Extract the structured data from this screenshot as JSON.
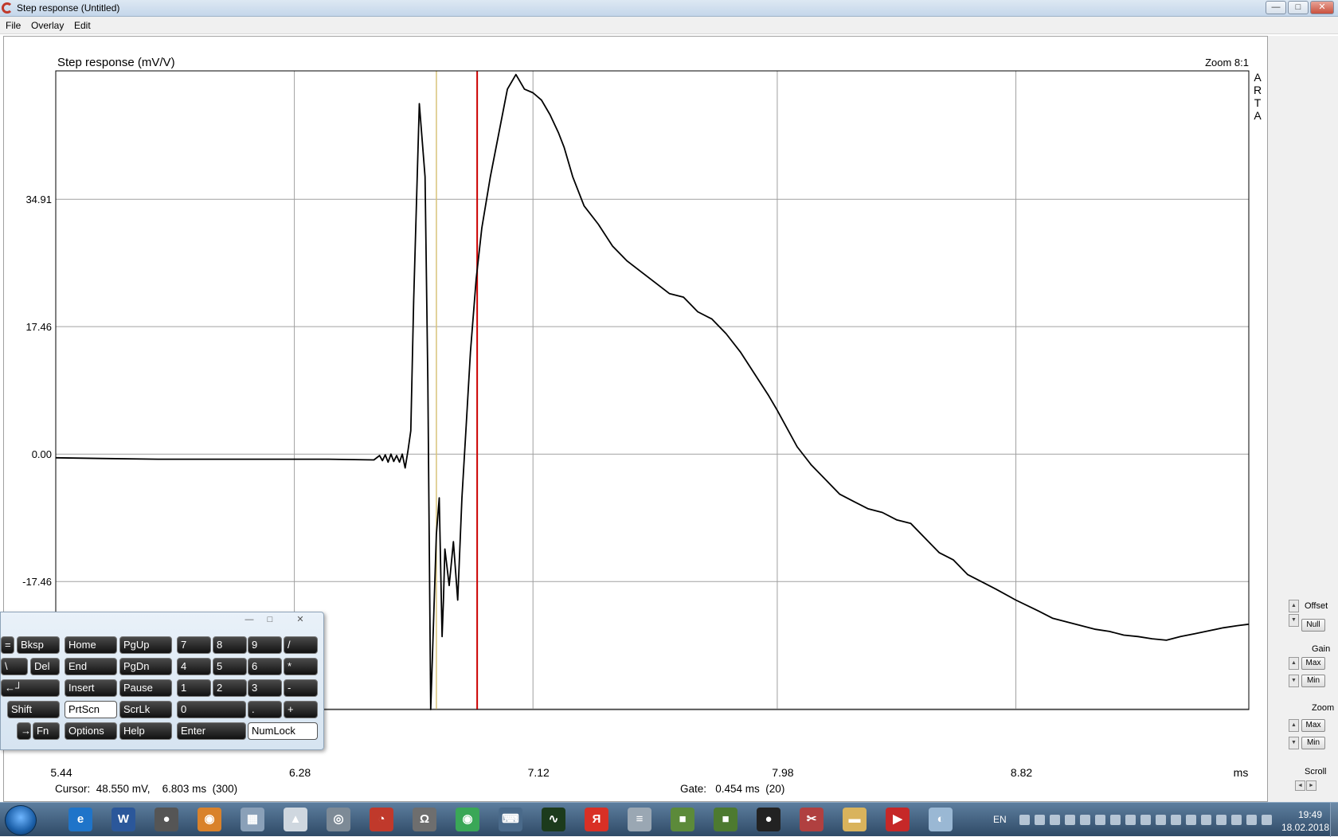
{
  "window": {
    "title": "Step response (Untitled)"
  },
  "menu": [
    "File",
    "Overlay",
    "Edit"
  ],
  "window_buttons": {
    "minimize": "—",
    "maximize": "□",
    "close": "✕"
  },
  "plot": {
    "title": "Step response (mV/V)",
    "zoom": "Zoom 8:1",
    "brand_letters": [
      "A",
      "R",
      "T",
      "A"
    ],
    "x_unit": "ms",
    "y_ticks": [
      "34.91",
      "17.46",
      "0.00",
      "-17.46"
    ],
    "x_ticks": [
      "5.44",
      "6.28",
      "7.12",
      "7.98",
      "8.82"
    ],
    "colors": {
      "trace": "#000000",
      "cursor": "#cc0000",
      "gate": "#d8c27a",
      "grid": "#a0a0a0"
    }
  },
  "chart_data": {
    "type": "line",
    "title": "Step response (mV/V)",
    "xlabel": "ms",
    "ylabel": "",
    "xlim": [
      5.44,
      9.64
    ],
    "ylim": [
      -35.0,
      52.5
    ],
    "x_ticks": [
      5.44,
      6.28,
      7.12,
      7.98,
      8.82
    ],
    "y_ticks": [
      34.91,
      17.46,
      0.0,
      -17.46
    ],
    "grid": true,
    "cursor_x": 6.803,
    "cursor_y": 48.55,
    "gate_x": 6.78,
    "series": [
      {
        "x": [
          5.44,
          5.6,
          5.8,
          6.0,
          6.2,
          6.4,
          6.56,
          6.58,
          6.59,
          6.6,
          6.61,
          6.62,
          6.63,
          6.64,
          6.65,
          6.66,
          6.67,
          6.68,
          6.69,
          6.7,
          6.72,
          6.74,
          6.75,
          6.76,
          6.78,
          6.79,
          6.8,
          6.805,
          6.81,
          6.825,
          6.84,
          6.855,
          6.87,
          6.885,
          6.9,
          6.92,
          6.94,
          6.97,
          7.0,
          7.03,
          7.06,
          7.09,
          7.12,
          7.15,
          7.18,
          7.21,
          7.23,
          7.26,
          7.3,
          7.35,
          7.4,
          7.45,
          7.5,
          7.55,
          7.6,
          7.65,
          7.7,
          7.75,
          7.8,
          7.85,
          7.9,
          7.95,
          7.98,
          8.05,
          8.1,
          8.15,
          8.2,
          8.25,
          8.3,
          8.35,
          8.4,
          8.45,
          8.5,
          8.55,
          8.6,
          8.65,
          8.7,
          8.75,
          8.82,
          8.9,
          8.95,
          9.0,
          9.05,
          9.1,
          9.15,
          9.2,
          9.25,
          9.3,
          9.35,
          9.4,
          9.45,
          9.5,
          9.55,
          9.6,
          9.64
        ],
        "y": [
          -0.5,
          -0.6,
          -0.7,
          -0.7,
          -0.7,
          -0.7,
          -0.8,
          -0.2,
          -0.9,
          -0.1,
          -1.1,
          0.0,
          -1.0,
          -0.2,
          -1.1,
          0.0,
          -1.9,
          0.5,
          3.2,
          21.0,
          48.0,
          38.0,
          10.0,
          -35.0,
          -11.0,
          -6.0,
          -25.0,
          -20.0,
          -13.0,
          -18.0,
          -12.0,
          -20.0,
          -6.0,
          4.0,
          14.0,
          24.0,
          31.0,
          38.0,
          44.0,
          50.0,
          52.0,
          50.0,
          49.5,
          48.5,
          46.5,
          44.0,
          42.0,
          38.0,
          34.0,
          31.5,
          28.5,
          26.5,
          25.0,
          23.5,
          22.0,
          21.5,
          19.5,
          18.5,
          16.5,
          14.0,
          11.0,
          8.0,
          6.0,
          1.0,
          -1.5,
          -3.5,
          -5.5,
          -6.5,
          -7.5,
          -8.0,
          -9.0,
          -9.5,
          -11.5,
          -13.5,
          -14.5,
          -16.5,
          -17.5,
          -18.5,
          -20.0,
          -21.5,
          -22.5,
          -23.0,
          -23.5,
          -24.0,
          -24.3,
          -24.8,
          -25.0,
          -25.3,
          -25.5,
          -25.0,
          -24.6,
          -24.2,
          -23.8,
          -23.5,
          -23.3
        ]
      }
    ]
  },
  "status": {
    "cursor": "Cursor:  48.550 mV,    6.803 ms  (300)",
    "gate": "Gate:   0.454 ms  (20)"
  },
  "right_panel": {
    "offset_label": "Offset",
    "null_button": "Null",
    "gain_label": "Gain",
    "zoom_label": "Zoom",
    "max_button": "Max",
    "min_button": "Min",
    "scroll_label": "Scroll",
    "up_arrow": "▲",
    "down_arrow": "▼",
    "left_arrow": "◄",
    "right_arrow": "►"
  },
  "keyboard": {
    "controls": {
      "minimize": "—",
      "restore": "□",
      "close": "✕"
    },
    "keys": {
      "eq": "=",
      "bksp": "Bksp",
      "home": "Home",
      "pgup": "PgUp",
      "n7": "7",
      "n8": "8",
      "n9": "9",
      "slash": "/",
      "backslash": "\\",
      "del": "Del",
      "end": "End",
      "pgdn": "PgDn",
      "n4": "4",
      "n5": "5",
      "n6": "6",
      "star": "*",
      "enter_main": "←┘",
      "insert": "Insert",
      "pause": "Pause",
      "n1": "1",
      "n2": "2",
      "n3": "3",
      "minus": "-",
      "shift": "Shift",
      "prtscn": "PrtScn",
      "scrlk": "ScrLk",
      "n0": "0",
      "dot": ".",
      "plus": "+",
      "right": "→",
      "fn": "Fn",
      "options": "Options",
      "help": "Help",
      "enter": "Enter",
      "numlock": "NumLock"
    }
  },
  "taskbar": {
    "apps": [
      {
        "name": "ie",
        "glyph": "e",
        "color": "#1f74c9"
      },
      {
        "name": "word",
        "glyph": "W",
        "color": "#2b579a"
      },
      {
        "name": "app-camera",
        "glyph": "●",
        "color": "#555555"
      },
      {
        "name": "app-eye",
        "glyph": "◉",
        "color": "#d9822b"
      },
      {
        "name": "calculator",
        "glyph": "▦",
        "color": "#8aa0b8"
      },
      {
        "name": "app-alien",
        "glyph": "▲",
        "color": "#cfd7df"
      },
      {
        "name": "app-target",
        "glyph": "◎",
        "color": "#7d8a96"
      },
      {
        "name": "arta",
        "glyph": "◔",
        "color": "#c0392b"
      },
      {
        "name": "app-omega",
        "glyph": "Ω",
        "color": "#6e6e6e"
      },
      {
        "name": "chrome",
        "glyph": "◉",
        "color": "#3aa757"
      },
      {
        "name": "app-keyboard",
        "glyph": "⌨",
        "color": "#4a6a8a"
      },
      {
        "name": "app-scope",
        "glyph": "∿",
        "color": "#1c3b1c"
      },
      {
        "name": "yandex",
        "glyph": "Я",
        "color": "#d93025"
      },
      {
        "name": "app-schematic",
        "glyph": "≡",
        "color": "#9aa7b3"
      },
      {
        "name": "minecraft-1",
        "glyph": "■",
        "color": "#5c8a3a"
      },
      {
        "name": "minecraft-2",
        "glyph": "■",
        "color": "#4d7a30"
      },
      {
        "name": "recorder",
        "glyph": "●",
        "color": "#222222"
      },
      {
        "name": "app-scissors",
        "glyph": "✂",
        "color": "#b04040"
      },
      {
        "name": "explorer",
        "glyph": "▬",
        "color": "#d9b35c"
      },
      {
        "name": "app-arrow",
        "glyph": "▶",
        "color": "#c62828"
      },
      {
        "name": "paint",
        "glyph": "◐",
        "color": "#9ab8d4"
      }
    ],
    "tray_language": "EN",
    "time": "19:49",
    "date": "18.02.2018"
  }
}
